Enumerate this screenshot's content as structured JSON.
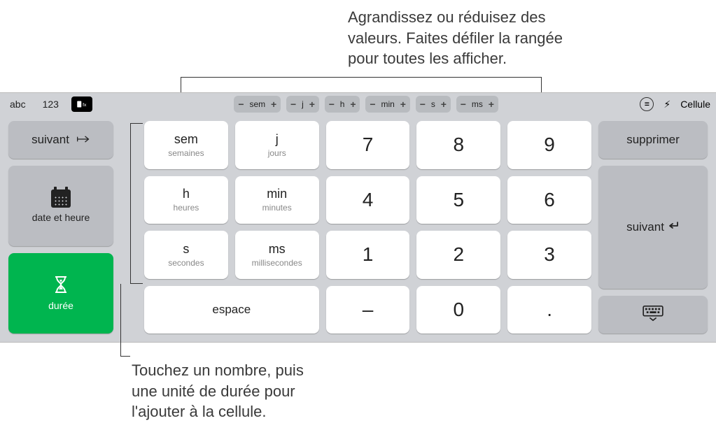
{
  "callouts": {
    "top": "Agrandissez ou réduisez des\nvaleurs. Faites défiler la rangée\npour toutes les afficher.",
    "bottom": "Touchez un nombre, puis\nune unité de durée pour\nl'ajouter à la cellule."
  },
  "topbar": {
    "abc": "abc",
    "num": "123",
    "cellule": "Cellule",
    "steppers": [
      "sem",
      "j",
      "h",
      "min",
      "s",
      "ms"
    ]
  },
  "left": {
    "suivant": "suivant",
    "date": "date et heure",
    "duree": "durée"
  },
  "units": [
    {
      "ab": "sem",
      "full": "semaines"
    },
    {
      "ab": "j",
      "full": "jours"
    },
    {
      "ab": "h",
      "full": "heures"
    },
    {
      "ab": "min",
      "full": "minutes"
    },
    {
      "ab": "s",
      "full": "secondes"
    },
    {
      "ab": "ms",
      "full": "millisecondes"
    }
  ],
  "espace": "espace",
  "numpad": {
    "r0": [
      "7",
      "8",
      "9"
    ],
    "r1": [
      "4",
      "5",
      "6"
    ],
    "r2": [
      "1",
      "2",
      "3"
    ],
    "r3": [
      "–",
      "0",
      "."
    ]
  },
  "right": {
    "supprimer": "supprimer",
    "suivant": "suivant"
  }
}
